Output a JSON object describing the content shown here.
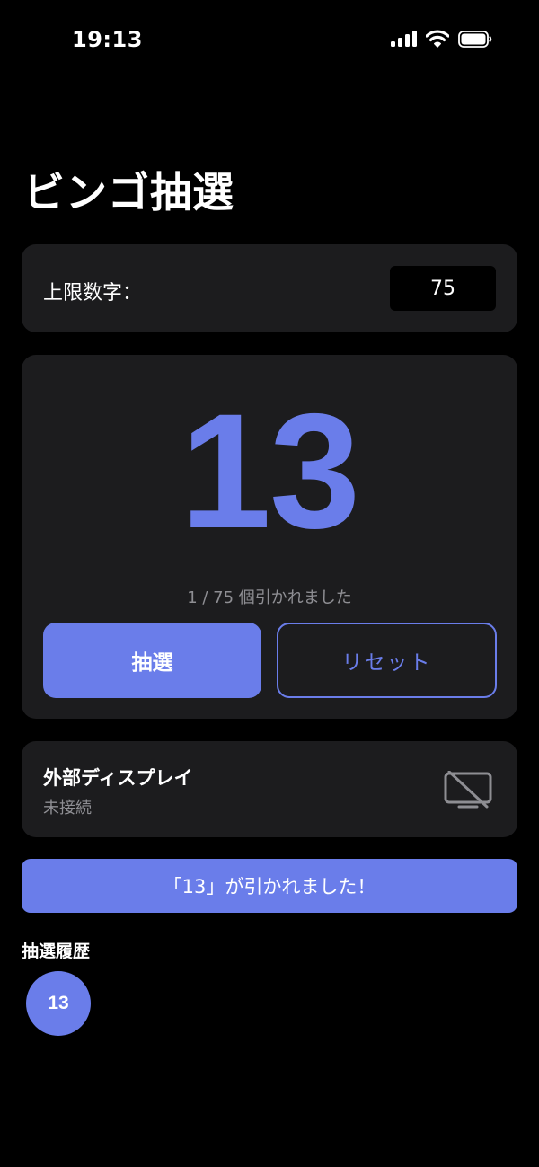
{
  "status_bar": {
    "time": "19:13",
    "icons": [
      "cellular-signal-icon",
      "wifi-icon",
      "battery-icon"
    ]
  },
  "title": "ビンゴ抽選",
  "limit": {
    "label": "上限数字：",
    "value": "75"
  },
  "draw": {
    "current_number": "13",
    "progress_text": "1 / 75 個引かれました",
    "draw_button": "抽選",
    "reset_button": "リセット"
  },
  "external_display": {
    "title": "外部ディスプレイ",
    "status": "未接続",
    "icon": "display-disconnected-icon"
  },
  "toast": {
    "message": "「13」が引かれました！"
  },
  "history": {
    "heading": "抽選履歴",
    "numbers": [
      "13"
    ]
  },
  "colors": {
    "background": "#000000",
    "card": "#1c1c1e",
    "accent": "#6a7dea",
    "secondary_text": "#8e8e93"
  }
}
